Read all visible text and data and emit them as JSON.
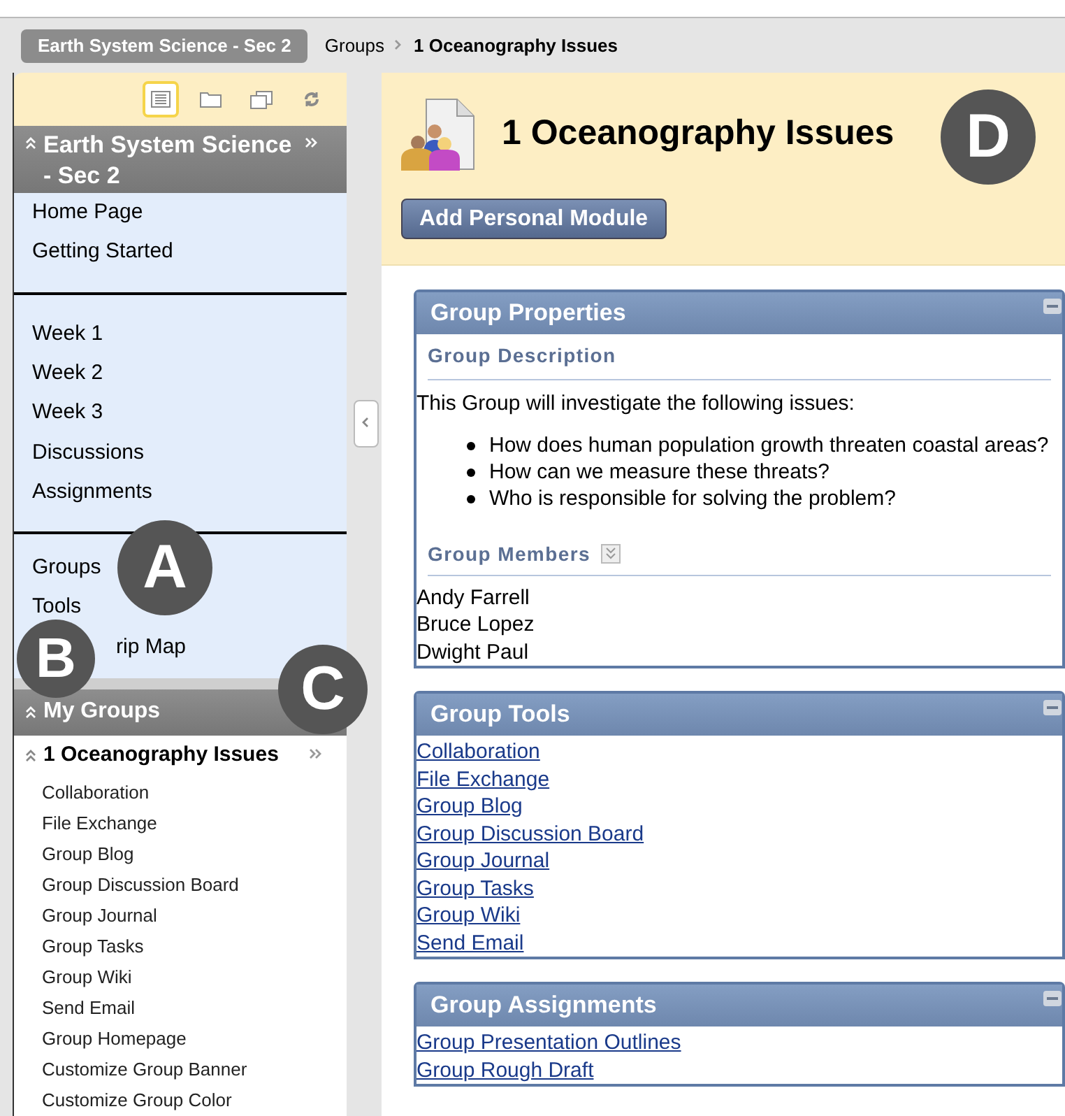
{
  "course_button": "Earth System Science - Sec 2",
  "breadcrumb": [
    {
      "label": "Groups",
      "current": false
    },
    {
      "label": "1 Oceanography Issues",
      "current": true
    }
  ],
  "menu_toolbar": [
    {
      "kind": "list",
      "selected": true
    },
    {
      "kind": "folder",
      "selected": false
    },
    {
      "kind": "windows",
      "selected": false
    },
    {
      "kind": "refresh",
      "selected": false
    }
  ],
  "course_menu": {
    "title": "Earth System Science - Sec 2",
    "sections": [
      [
        "Home Page",
        "Getting Started"
      ],
      [
        "Week 1",
        "Week 2",
        "Week 3",
        "Discussions",
        "Assignments"
      ],
      [
        "Groups",
        "Tools",
        "rip Map"
      ]
    ]
  },
  "my_groups": {
    "title": "My Groups",
    "group": "1 Oceanography Issues",
    "items": [
      "Collaboration",
      "File Exchange",
      "Group Blog",
      "Group Discussion Board",
      "Group Journal",
      "Group Tasks",
      "Group Wiki",
      "Send Email",
      "Group Homepage",
      "Customize Group Banner",
      "Customize Group Color"
    ]
  },
  "page_title": "1 Oceanography Issues",
  "add_module_button": "Add Personal Module",
  "modules": [
    {
      "kind": "properties",
      "title": "Group Properties",
      "description_heading": "Group Description",
      "intro": "This Group will investigate the following issues:",
      "bullets": [
        "How does human population growth threaten coastal areas?",
        "How can we measure these threats?",
        "Who is responsible for solving the problem?"
      ],
      "members_heading": "Group Members",
      "members": [
        "Andy Farrell",
        "Bruce Lopez",
        "Dwight Paul"
      ]
    },
    {
      "kind": "links",
      "title": "Group Tools",
      "links": [
        "Collaboration",
        "File Exchange",
        "Group Blog",
        "Group Discussion Board",
        "Group Journal",
        "Group Tasks",
        "Group Wiki",
        "Send Email"
      ]
    },
    {
      "kind": "links",
      "title": "Group Assignments",
      "links": [
        "Group Presentation Outlines",
        "Group Rough Draft"
      ]
    }
  ],
  "callouts": [
    "A",
    "B",
    "C",
    "D"
  ]
}
